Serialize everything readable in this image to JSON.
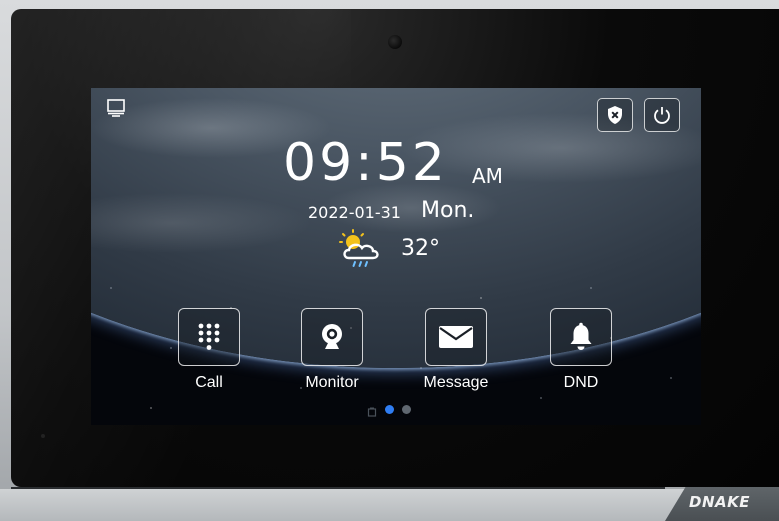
{
  "device": {
    "brand_logo": "DNAKE"
  },
  "status_bar": {
    "left_icon": "monitor-screen-icon",
    "security_icon": "shield-x-icon",
    "power_icon": "power-icon"
  },
  "clock": {
    "time": "09:52",
    "ampm": "AM",
    "date": "2022-01-31",
    "weekday": "Mon."
  },
  "weather": {
    "icon": "sun-cloud-rain-icon",
    "temperature": "32°"
  },
  "apps": [
    {
      "label": "Call",
      "icon": "keypad-icon"
    },
    {
      "label": "Monitor",
      "icon": "webcam-icon"
    },
    {
      "label": "Message",
      "icon": "envelope-icon"
    },
    {
      "label": "DND",
      "icon": "bell-icon"
    }
  ],
  "pager": {
    "pages": 2,
    "active_page": 1
  },
  "colors": {
    "accent": "#2f7df2",
    "text": "#ffffff"
  }
}
